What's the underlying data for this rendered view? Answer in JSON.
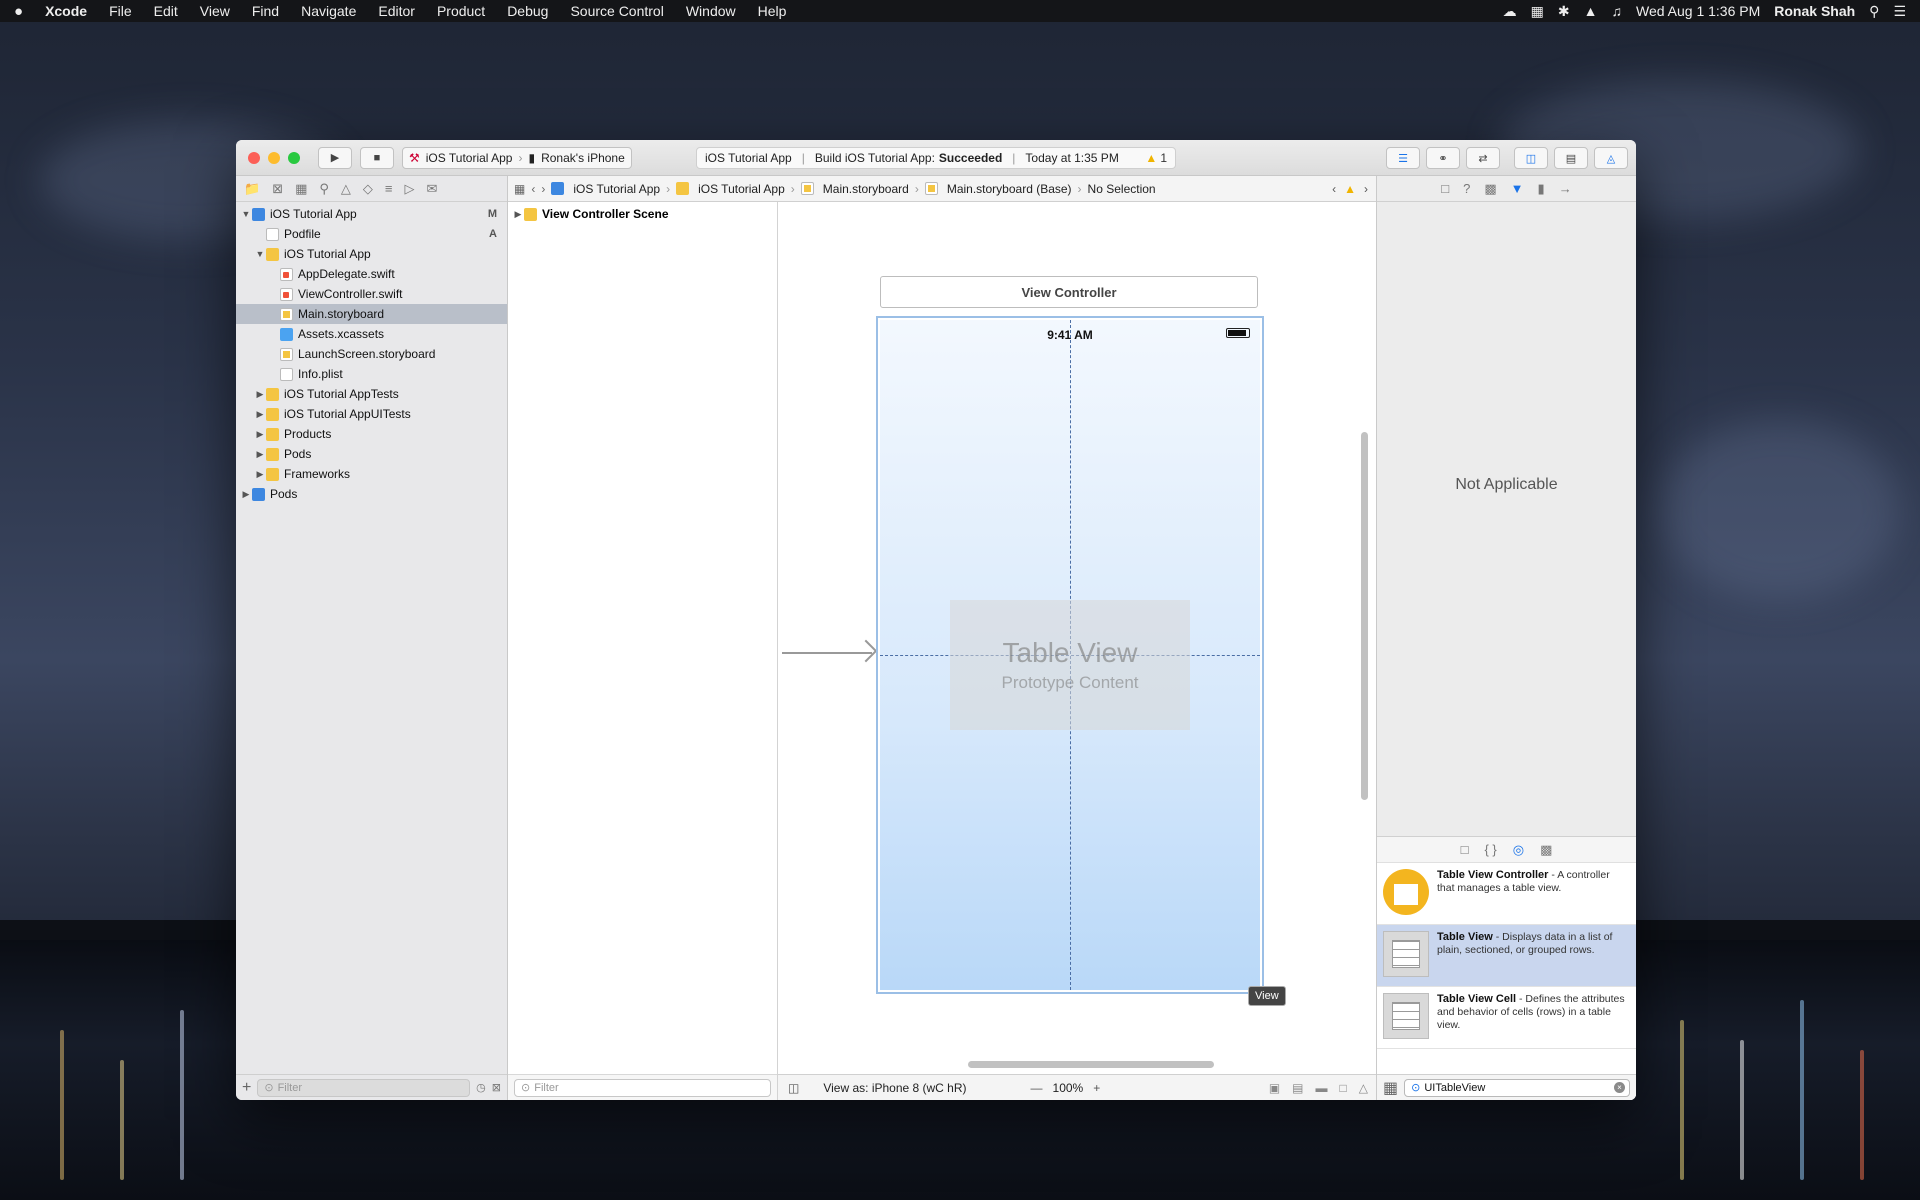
{
  "menubar": {
    "apple": "",
    "app_name": "Xcode",
    "items": [
      "File",
      "Edit",
      "View",
      "Find",
      "Navigate",
      "Editor",
      "Product",
      "Debug",
      "Source Control",
      "Window",
      "Help"
    ],
    "clock": "Wed Aug 1  1:36 PM",
    "user": "Ronak Shah"
  },
  "toolbar": {
    "scheme": "iOS Tutorial App",
    "device": "Ronak's iPhone",
    "activity_project": "iOS Tutorial App",
    "activity_build": "Build iOS Tutorial App:",
    "activity_status": "Succeeded",
    "activity_time": "Today at 1:35 PM",
    "warning_count": "1"
  },
  "navigator": {
    "tree": [
      {
        "label": "iOS Tutorial App",
        "badge": "M"
      },
      {
        "label": "Podfile",
        "badge": "A"
      },
      {
        "label": "iOS Tutorial App"
      },
      {
        "label": "AppDelegate.swift"
      },
      {
        "label": "ViewController.swift"
      },
      {
        "label": "Main.storyboard"
      },
      {
        "label": "Assets.xcassets"
      },
      {
        "label": "LaunchScreen.storyboard"
      },
      {
        "label": "Info.plist"
      },
      {
        "label": "iOS Tutorial AppTests"
      },
      {
        "label": "iOS Tutorial AppUITests"
      },
      {
        "label": "Products"
      },
      {
        "label": "Pods"
      },
      {
        "label": "Frameworks"
      },
      {
        "label": "Pods"
      }
    ],
    "filter_placeholder": "Filter"
  },
  "jumpbar": {
    "crumbs": [
      "iOS Tutorial App",
      "iOS Tutorial App",
      "Main.storyboard",
      "Main.storyboard (Base)",
      "No Selection"
    ]
  },
  "outline": {
    "scene": "View Controller Scene",
    "filter_placeholder": "Filter"
  },
  "canvas": {
    "vc_title": "View Controller",
    "time": "9:41 AM",
    "table_title": "Table View",
    "table_sub": "Prototype Content",
    "view_tag": "View",
    "view_as": "View as: iPhone 8 (wC hR)",
    "zoom_minus": "—",
    "zoom": "100%",
    "zoom_plus": "+"
  },
  "inspector": {
    "not_applicable": "Not Applicable"
  },
  "library": {
    "items": [
      {
        "title": "Table View Controller",
        "desc": " - A controller that manages a table view."
      },
      {
        "title": "Table View",
        "desc": " - Displays data in a list of plain, sectioned, or grouped rows."
      },
      {
        "title": "Table View Cell",
        "desc": " - Defines the attributes and behavior of cells (rows) in a table view."
      }
    ],
    "filter_value": "UITableView"
  },
  "colors": {
    "selection": "#b9bfc9",
    "accent": "#1a73e8",
    "warning": "#f0b400"
  }
}
